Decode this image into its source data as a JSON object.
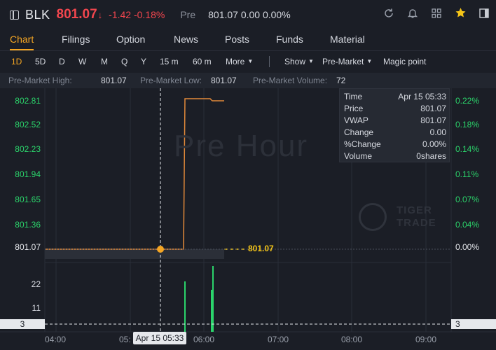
{
  "header": {
    "symbol": "BLK",
    "price": "801.07",
    "price_arrow": "↓",
    "change": "-1.42",
    "change_pct": "-0.18%",
    "pre_label": "Pre",
    "pre_values": "801.07 0.00 0.00%",
    "icons": [
      "refresh-icon",
      "bell-icon",
      "grid-icon",
      "star-icon",
      "panel-icon"
    ]
  },
  "tabs": [
    "Chart",
    "Filings",
    "Option",
    "News",
    "Posts",
    "Funds",
    "Material"
  ],
  "active_tab": "Chart",
  "period": {
    "items": [
      "1D",
      "5D",
      "D",
      "W",
      "M",
      "Q",
      "Y",
      "15 m",
      "60 m",
      "More"
    ],
    "active": "1D",
    "show_label": "Show",
    "session_label": "Pre-Market",
    "magic_label": "Magic point"
  },
  "stats": {
    "high_label": "Pre-Market High:",
    "high_value": "801.07",
    "low_label": "Pre-Market Low:",
    "low_value": "801.07",
    "volume_label": "Pre-Market Volume:",
    "volume_value": "72"
  },
  "chart": {
    "watermark": "Pre Hour",
    "brand_line1": "TIGER",
    "brand_line2": "TRADE",
    "y_left": [
      "802.81",
      "802.52",
      "802.23",
      "801.94",
      "801.65",
      "801.36",
      "801.07"
    ],
    "y_right": [
      "0.22%",
      "0.18%",
      "0.14%",
      "0.11%",
      "0.07%",
      "0.04%",
      "0.00%"
    ],
    "last_price_label": "801.07",
    "vol_axis": [
      "22",
      "11"
    ],
    "crosshair_volume": "3",
    "crosshair_time": "Apr 15 05:33",
    "x_ticks": [
      "04:00",
      "05:",
      "06:00",
      "07:00",
      "08:00",
      "09:00"
    ],
    "colors": {
      "up": "#2bd46b",
      "down": "#f2464e",
      "accent": "#f5a623",
      "line": "#e38a3a"
    }
  },
  "tooltip": {
    "rows": [
      {
        "k": "Time",
        "v": "Apr 15 05:33"
      },
      {
        "k": "Price",
        "v": "801.07"
      },
      {
        "k": "VWAP",
        "v": "801.07"
      },
      {
        "k": "Change",
        "v": "0.00"
      },
      {
        "k": "%Change",
        "v": "0.00%"
      },
      {
        "k": "Volume",
        "v": "0shares"
      }
    ]
  }
}
